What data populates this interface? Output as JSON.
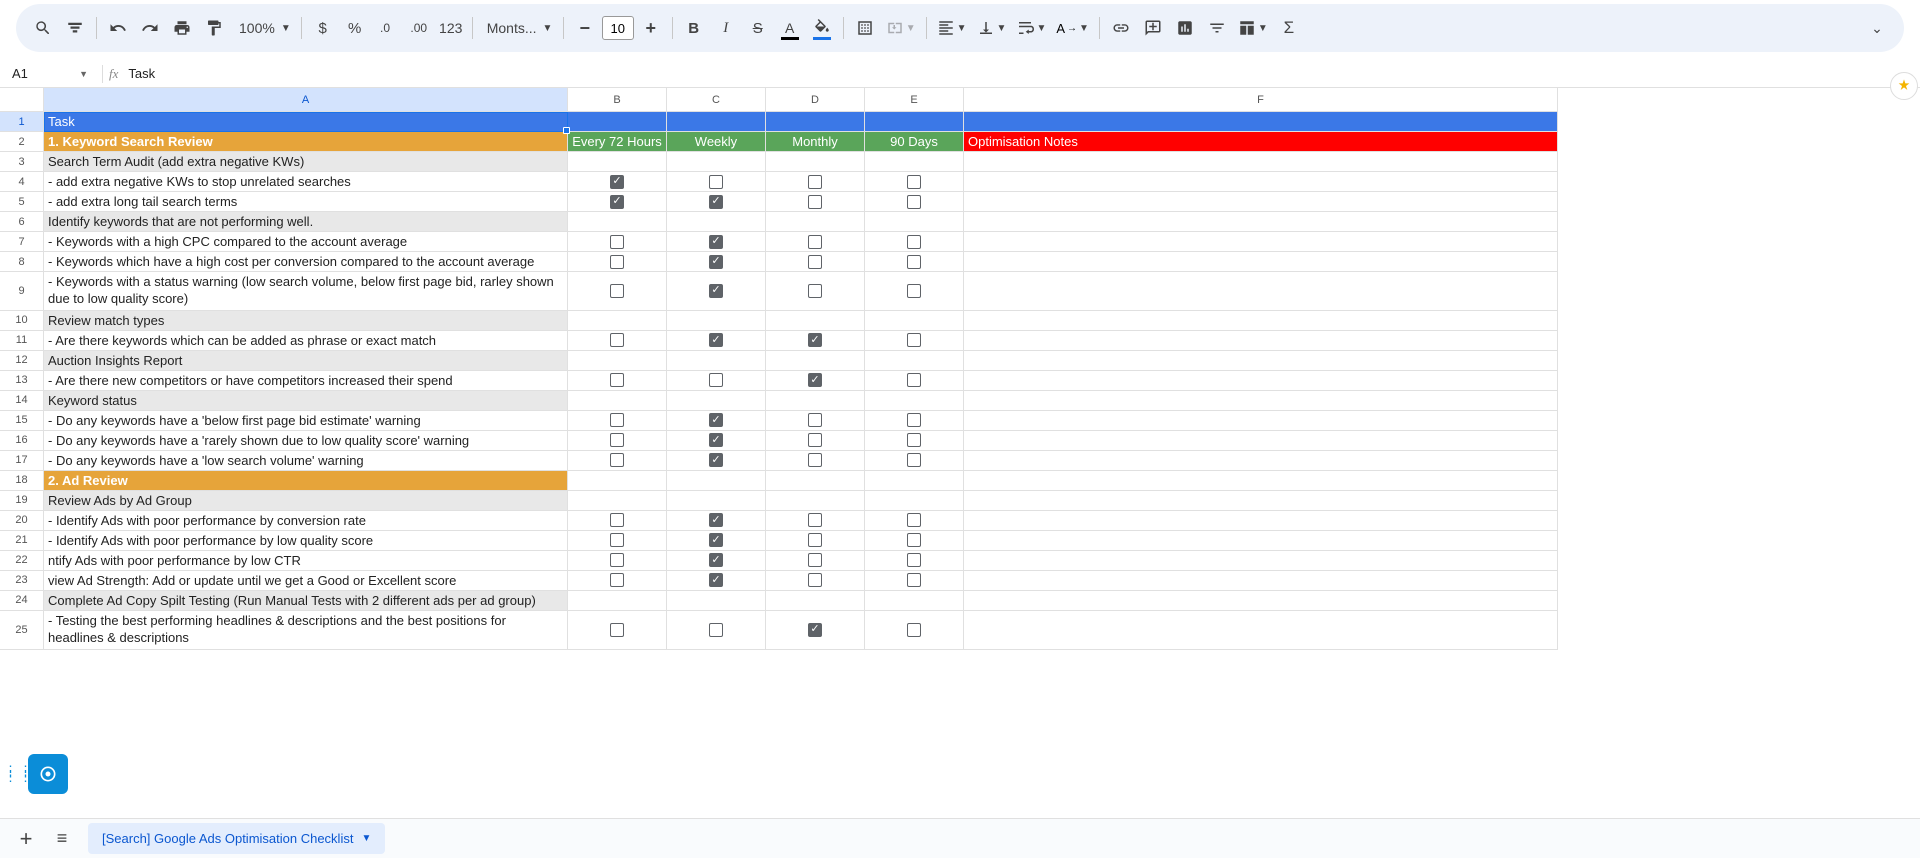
{
  "toolbar": {
    "zoom": "100%",
    "font_name": "Monts...",
    "font_size": "10",
    "number_fmt": "123"
  },
  "namebox": "A1",
  "fx_label": "fx",
  "formula_value": "Task",
  "columns": [
    "A",
    "B",
    "C",
    "D",
    "E",
    "F"
  ],
  "sheet_tab": "[Search] Google Ads Optimisation Checklist",
  "rows": [
    {
      "n": 1,
      "type": "header-blue",
      "a": "Task"
    },
    {
      "n": 2,
      "type": "orange-green",
      "a": "1. Keyword Search Review",
      "b": "Every 72 Hours",
      "c": "Weekly",
      "d": "Monthly",
      "e": "90 Days",
      "f": "Optimisation Notes"
    },
    {
      "n": 3,
      "type": "grey",
      "a": "Search Term Audit (add extra negative KWs)"
    },
    {
      "n": 4,
      "type": "chk",
      "a": "- add extra negative KWs to stop unrelated searches",
      "b": true,
      "c": false,
      "d": false,
      "e": false
    },
    {
      "n": 5,
      "type": "chk",
      "a": "- add extra long tail search terms",
      "b": true,
      "c": true,
      "d": false,
      "e": false
    },
    {
      "n": 6,
      "type": "grey",
      "a": "Identify keywords that are not performing well."
    },
    {
      "n": 7,
      "type": "chk",
      "a": "- Keywords with a high CPC compared to the account average",
      "b": false,
      "c": true,
      "d": false,
      "e": false
    },
    {
      "n": 8,
      "type": "chk",
      "a": "- Keywords which have a high cost per conversion compared to the account average",
      "b": false,
      "c": true,
      "d": false,
      "e": false
    },
    {
      "n": 9,
      "type": "chk",
      "a": "- Keywords with a status warning (low search volume, below first page bid, rarley shown due to low quality score)",
      "b": false,
      "c": true,
      "d": false,
      "e": false,
      "tall": true
    },
    {
      "n": 10,
      "type": "grey",
      "a": "Review match types"
    },
    {
      "n": 11,
      "type": "chk",
      "a": "- Are there keywords which can be added as phrase or exact match",
      "b": false,
      "c": true,
      "d": true,
      "e": false
    },
    {
      "n": 12,
      "type": "grey",
      "a": "Auction Insights Report"
    },
    {
      "n": 13,
      "type": "chk",
      "a": "- Are there new competitors or have competitors increased their spend",
      "b": false,
      "c": false,
      "d": true,
      "e": false
    },
    {
      "n": 14,
      "type": "grey",
      "a": "Keyword status"
    },
    {
      "n": 15,
      "type": "chk",
      "a": "- Do any keywords have a 'below first page bid estimate' warning",
      "b": false,
      "c": true,
      "d": false,
      "e": false
    },
    {
      "n": 16,
      "type": "chk",
      "a": "- Do any keywords have a 'rarely shown due to low quality score' warning",
      "b": false,
      "c": true,
      "d": false,
      "e": false
    },
    {
      "n": 17,
      "type": "chk",
      "a": "- Do any keywords have a 'low search volume' warning",
      "b": false,
      "c": true,
      "d": false,
      "e": false
    },
    {
      "n": 18,
      "type": "orange",
      "a": "2. Ad Review"
    },
    {
      "n": 19,
      "type": "grey",
      "a": "Review Ads by Ad Group"
    },
    {
      "n": 20,
      "type": "chk",
      "a": "- Identify Ads with poor performance by conversion rate",
      "b": false,
      "c": true,
      "d": false,
      "e": false
    },
    {
      "n": 21,
      "type": "chk",
      "a": "- Identify Ads with poor performance by low quality score",
      "b": false,
      "c": true,
      "d": false,
      "e": false
    },
    {
      "n": 22,
      "type": "chk",
      "a": "ntify Ads with poor performance by low CTR",
      "b": false,
      "c": true,
      "d": false,
      "e": false,
      "cut": true
    },
    {
      "n": 23,
      "type": "chk",
      "a": "view Ad Strength: Add or update until we get a Good or Excellent score",
      "b": false,
      "c": true,
      "d": false,
      "e": false,
      "cut": true
    },
    {
      "n": 24,
      "type": "grey",
      "a": "Complete Ad Copy Spilt Testing (Run Manual Tests with 2 different ads per ad group)"
    },
    {
      "n": 25,
      "type": "chk",
      "a": "- Testing the best performing headlines & descriptions and the best positions for headlines & descriptions",
      "b": false,
      "c": false,
      "d": true,
      "e": false,
      "tall": true
    }
  ]
}
